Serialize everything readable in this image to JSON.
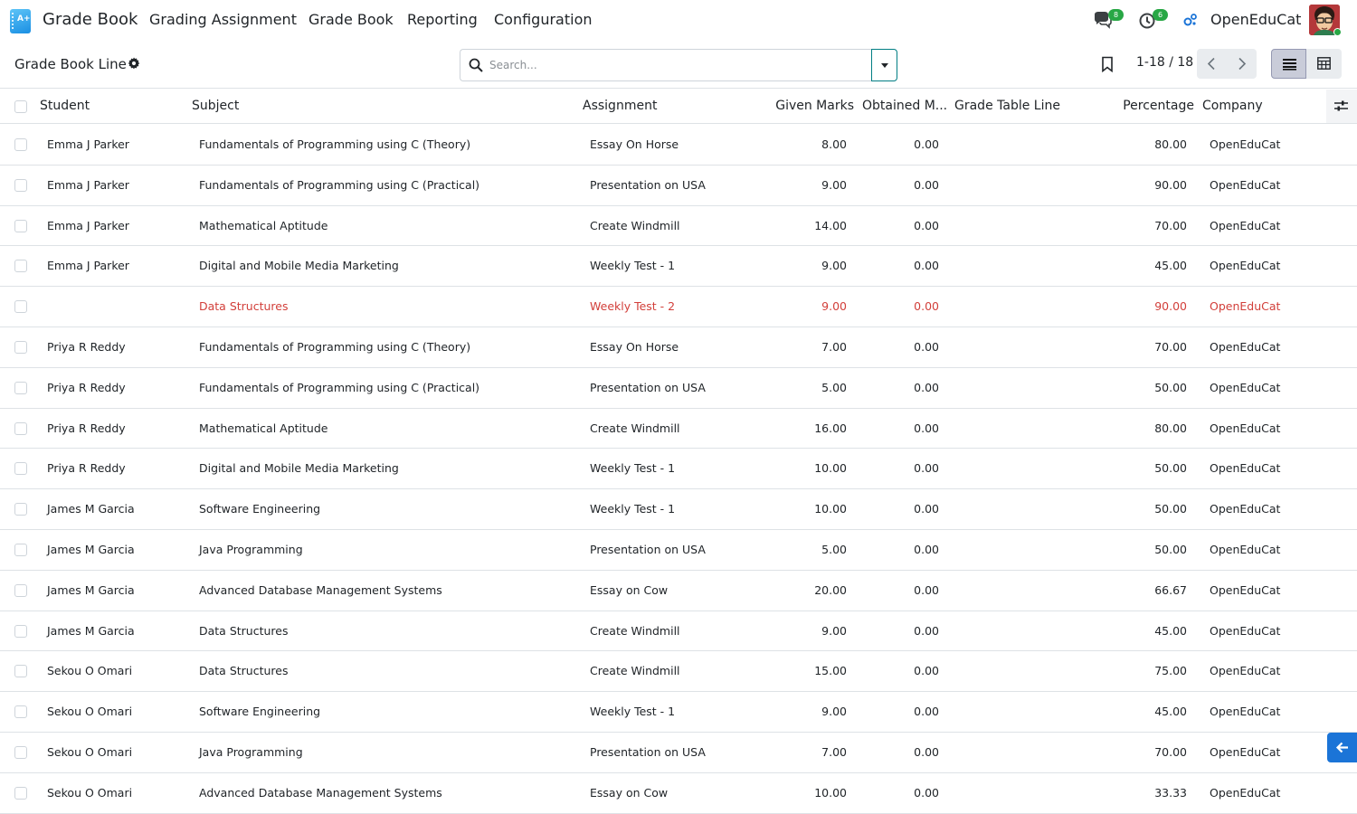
{
  "navbar": {
    "brand": "Grade Book",
    "menus": [
      "Grading Assignment",
      "Grade Book",
      "Reporting",
      "Configuration"
    ],
    "messages_count": "8",
    "activities_count": "6",
    "company": "OpenEduCat"
  },
  "control_panel": {
    "breadcrumb": "Grade Book Line",
    "search_placeholder": "Search...",
    "pager": "1-18 / 18"
  },
  "table": {
    "columns": {
      "student": "Student",
      "subject": "Subject",
      "assignment": "Assignment",
      "given_marks": "Given Marks",
      "obtained_marks": "Obtained M...",
      "grade_table_line": "Grade Table Line",
      "percentage": "Percentage",
      "company": "Company"
    },
    "rows": [
      {
        "student": "Emma J Parker",
        "subject": "Fundamentals of Programming using C (Theory)",
        "assignment": "Essay On Horse",
        "given": "8.00",
        "obtained": "0.00",
        "grade_line": "",
        "percentage": "80.00",
        "company": "OpenEduCat",
        "danger": false
      },
      {
        "student": "Emma J Parker",
        "subject": "Fundamentals of Programming using C (Practical)",
        "assignment": "Presentation on USA",
        "given": "9.00",
        "obtained": "0.00",
        "grade_line": "",
        "percentage": "90.00",
        "company": "OpenEduCat",
        "danger": false
      },
      {
        "student": "Emma J Parker",
        "subject": "Mathematical Aptitude",
        "assignment": "Create Windmill",
        "given": "14.00",
        "obtained": "0.00",
        "grade_line": "",
        "percentage": "70.00",
        "company": "OpenEduCat",
        "danger": false
      },
      {
        "student": "Emma J Parker",
        "subject": "Digital and Mobile Media Marketing",
        "assignment": "Weekly Test - 1",
        "given": "9.00",
        "obtained": "0.00",
        "grade_line": "",
        "percentage": "45.00",
        "company": "OpenEduCat",
        "danger": false
      },
      {
        "student": "",
        "subject": "Data Structures",
        "assignment": "Weekly Test - 2",
        "given": "9.00",
        "obtained": "0.00",
        "grade_line": "",
        "percentage": "90.00",
        "company": "OpenEduCat",
        "danger": true
      },
      {
        "student": "Priya R Reddy",
        "subject": "Fundamentals of Programming using C (Theory)",
        "assignment": "Essay On Horse",
        "given": "7.00",
        "obtained": "0.00",
        "grade_line": "",
        "percentage": "70.00",
        "company": "OpenEduCat",
        "danger": false
      },
      {
        "student": "Priya R Reddy",
        "subject": "Fundamentals of Programming using C (Practical)",
        "assignment": "Presentation on USA",
        "given": "5.00",
        "obtained": "0.00",
        "grade_line": "",
        "percentage": "50.00",
        "company": "OpenEduCat",
        "danger": false
      },
      {
        "student": "Priya R Reddy",
        "subject": "Mathematical Aptitude",
        "assignment": "Create Windmill",
        "given": "16.00",
        "obtained": "0.00",
        "grade_line": "",
        "percentage": "80.00",
        "company": "OpenEduCat",
        "danger": false
      },
      {
        "student": "Priya R Reddy",
        "subject": "Digital and Mobile Media Marketing",
        "assignment": "Weekly Test - 1",
        "given": "10.00",
        "obtained": "0.00",
        "grade_line": "",
        "percentage": "50.00",
        "company": "OpenEduCat",
        "danger": false
      },
      {
        "student": "James M Garcia",
        "subject": "Software Engineering",
        "assignment": "Weekly Test - 1",
        "given": "10.00",
        "obtained": "0.00",
        "grade_line": "",
        "percentage": "50.00",
        "company": "OpenEduCat",
        "danger": false
      },
      {
        "student": "James M Garcia",
        "subject": "Java Programming",
        "assignment": "Presentation on USA",
        "given": "5.00",
        "obtained": "0.00",
        "grade_line": "",
        "percentage": "50.00",
        "company": "OpenEduCat",
        "danger": false
      },
      {
        "student": "James M Garcia",
        "subject": "Advanced Database Management Systems",
        "assignment": "Essay on Cow",
        "given": "20.00",
        "obtained": "0.00",
        "grade_line": "",
        "percentage": "66.67",
        "company": "OpenEduCat",
        "danger": false
      },
      {
        "student": "James M Garcia",
        "subject": "Data Structures",
        "assignment": "Create Windmill",
        "given": "9.00",
        "obtained": "0.00",
        "grade_line": "",
        "percentage": "45.00",
        "company": "OpenEduCat",
        "danger": false
      },
      {
        "student": "Sekou O Omari",
        "subject": "Data Structures",
        "assignment": "Create Windmill",
        "given": "15.00",
        "obtained": "0.00",
        "grade_line": "",
        "percentage": "75.00",
        "company": "OpenEduCat",
        "danger": false
      },
      {
        "student": "Sekou O Omari",
        "subject": "Software Engineering",
        "assignment": "Weekly Test - 1",
        "given": "9.00",
        "obtained": "0.00",
        "grade_line": "",
        "percentage": "45.00",
        "company": "OpenEduCat",
        "danger": false
      },
      {
        "student": "Sekou O Omari",
        "subject": "Java Programming",
        "assignment": "Presentation on USA",
        "given": "7.00",
        "obtained": "0.00",
        "grade_line": "",
        "percentage": "70.00",
        "company": "OpenEduCat",
        "danger": false
      },
      {
        "student": "Sekou O Omari",
        "subject": "Advanced Database Management Systems",
        "assignment": "Essay on Cow",
        "given": "10.00",
        "obtained": "0.00",
        "grade_line": "",
        "percentage": "33.33",
        "company": "OpenEduCat",
        "danger": false
      }
    ]
  },
  "icons": {
    "app": "grade-book-app-icon",
    "messages": "chat-bubbles-icon",
    "activities": "clock-icon",
    "company_switch": "company-switch-icon",
    "search": "search-icon",
    "favorites": "bookmark-icon",
    "optional_columns": "sliders-icon",
    "chatter_toggle": "arrow-left-icon"
  },
  "colors": {
    "accent": "#017e84",
    "danger_row": "#d23f3a",
    "badge": "#28a745",
    "side_button": "#1b74d7"
  }
}
